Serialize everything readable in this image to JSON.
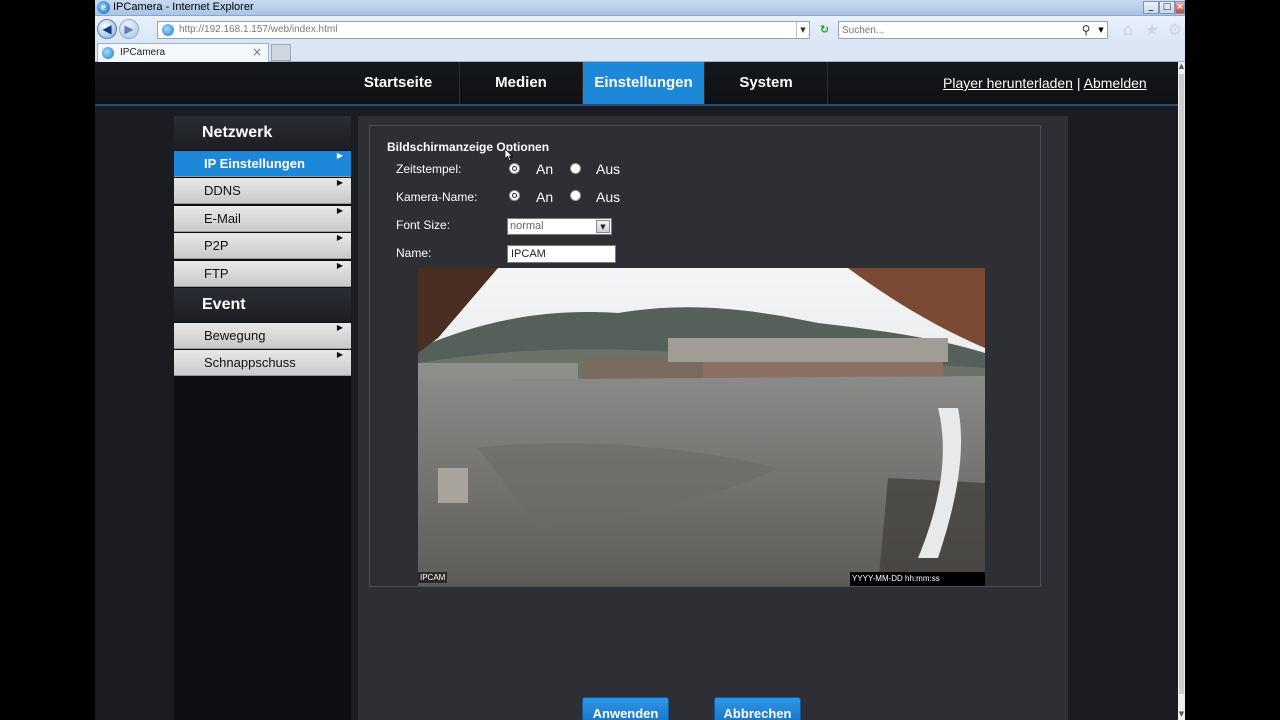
{
  "window": {
    "title": "IPCamera - Internet Explorer",
    "minimize": "_",
    "maximize": "□",
    "close": "×"
  },
  "addressbar": {
    "back": "◀",
    "forward": "▶",
    "url": "http://192.168.1.157/web/index.html",
    "dropdown": "▼",
    "refresh": "↻",
    "search_placeholder": "Suchen...",
    "search_icon": "⚲"
  },
  "toolbar_icons": [
    "home-icon",
    "favorites-star-icon",
    "tools-gear-icon"
  ],
  "tab": {
    "label": "IPCamera",
    "close": "×"
  },
  "topnav": {
    "tabs": [
      {
        "label": "Startseite",
        "active": false
      },
      {
        "label": "Medien",
        "active": false
      },
      {
        "label": "Einstellungen",
        "active": true
      },
      {
        "label": "System",
        "active": false
      }
    ],
    "download_link": "Player herunterladen",
    "separator": "|",
    "logout_link": "Abmelden"
  },
  "sidebar": {
    "sections": [
      {
        "heading": "Netzwerk",
        "items": [
          {
            "label": "IP Einstellungen",
            "active": true
          },
          {
            "label": "DDNS",
            "active": false
          },
          {
            "label": "E-Mail",
            "active": false
          },
          {
            "label": "P2P",
            "active": false
          },
          {
            "label": "FTP",
            "active": false
          }
        ]
      },
      {
        "heading": "Event",
        "items": [
          {
            "label": "Bewegung",
            "active": false
          },
          {
            "label": "Schnappschuss",
            "active": false
          }
        ]
      }
    ],
    "arrow": "▶"
  },
  "osd": {
    "title": "Bildschirmanzeige Optionen",
    "timestamp": {
      "label": "Zeitstempel:",
      "on": "An",
      "off": "Aus",
      "selected": "An"
    },
    "camera_name": {
      "label": "Kamera-Name:",
      "on": "An",
      "off": "Aus",
      "selected": "An"
    },
    "font_size": {
      "label": "Font Size:",
      "value": "normal",
      "dropdown": "▼"
    },
    "name": {
      "label": "Name:",
      "value": "IPCAM"
    }
  },
  "preview": {
    "name_overlay": "IPCAM",
    "time_overlay": "YYYY-MM-DD hh:mm:ss"
  },
  "buttons": {
    "apply": "Anwenden",
    "cancel": "Abbrechen"
  },
  "colors": {
    "accent": "#1e88d8",
    "background": "#1a1c21",
    "panel": "#2d2f34"
  }
}
